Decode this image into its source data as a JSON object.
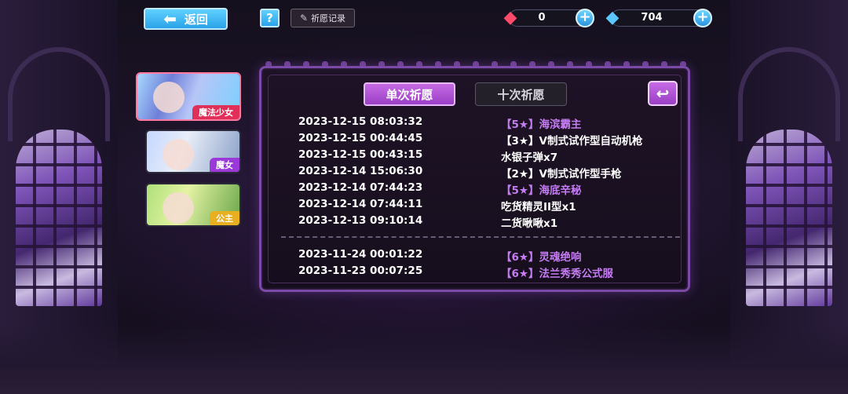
{
  "top_bar": {
    "back_label": "返回",
    "help_label": "?",
    "record_label": "祈愿记录"
  },
  "currencies": [
    {
      "name": "red-crystal",
      "value": "0",
      "color": "#ff4a6a"
    },
    {
      "name": "blue-crystal",
      "value": "704",
      "color": "#5bc6ff"
    }
  ],
  "char_tabs": [
    {
      "label": "魔法少女",
      "selected": true
    },
    {
      "label": "魔女",
      "selected": false
    },
    {
      "label": "公主",
      "selected": false
    }
  ],
  "panel": {
    "tab_single": "单次祈愿",
    "tab_ten": "十次祈愿",
    "return_icon": "↩"
  },
  "records_recent": [
    {
      "time": "2023-12-15 08:03:32",
      "item": "【5★】海滨霸主",
      "rare": true
    },
    {
      "time": "2023-12-15 00:44:45",
      "item": "【3★】V制式试作型自动机枪",
      "rare": false
    },
    {
      "time": "2023-12-15 00:43:15",
      "item": "水银子弹x7",
      "rare": false
    },
    {
      "time": "2023-12-14 15:06:30",
      "item": "【2★】V制式试作型手枪",
      "rare": false
    },
    {
      "time": "2023-12-14 07:44:23",
      "item": "【5★】海底辛秘",
      "rare": true
    },
    {
      "time": "2023-12-14 07:44:11",
      "item": "吃货精灵II型x1",
      "rare": false
    },
    {
      "time": "2023-12-13 09:10:14",
      "item": "二货啾啾x1",
      "rare": false
    }
  ],
  "records_older": [
    {
      "time": "2023-11-24 00:01:22",
      "item": "【6★】灵魂绝响",
      "rare": true
    },
    {
      "time": "2023-11-23 00:07:25",
      "item": "【6★】法兰秀秀公式服",
      "rare": true
    }
  ]
}
